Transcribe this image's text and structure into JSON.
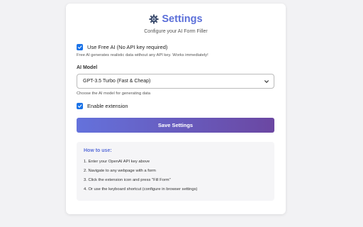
{
  "header": {
    "icon": "gear-icon",
    "title": "Settings",
    "subtitle": "Configure your AI Form Filler"
  },
  "free_ai": {
    "checked": true,
    "label": "Use Free AI (No API key required)",
    "hint": "Free AI generates realistic data without any API key. Works immediately!"
  },
  "model": {
    "label": "AI Model",
    "selected": "GPT-3.5 Turbo (Fast & Cheap)",
    "hint": "Choose the AI model for generating data"
  },
  "enable_extension": {
    "checked": true,
    "label": "Enable extension"
  },
  "save_button": {
    "label": "Save Settings"
  },
  "how_to": {
    "title": "How to use:",
    "steps": [
      "1. Enter your OpenAI API key above",
      "2. Navigate to any webpage with a form",
      "3. Click the extension icon and press \"Fill Form\"",
      "4. Or use the keyboard shortcut (configure in browser settings)"
    ]
  },
  "colors": {
    "accent": "#5b6fd9",
    "checkbox": "#1a73e8",
    "button_start": "#6472dc",
    "button_end": "#6b47a2"
  }
}
